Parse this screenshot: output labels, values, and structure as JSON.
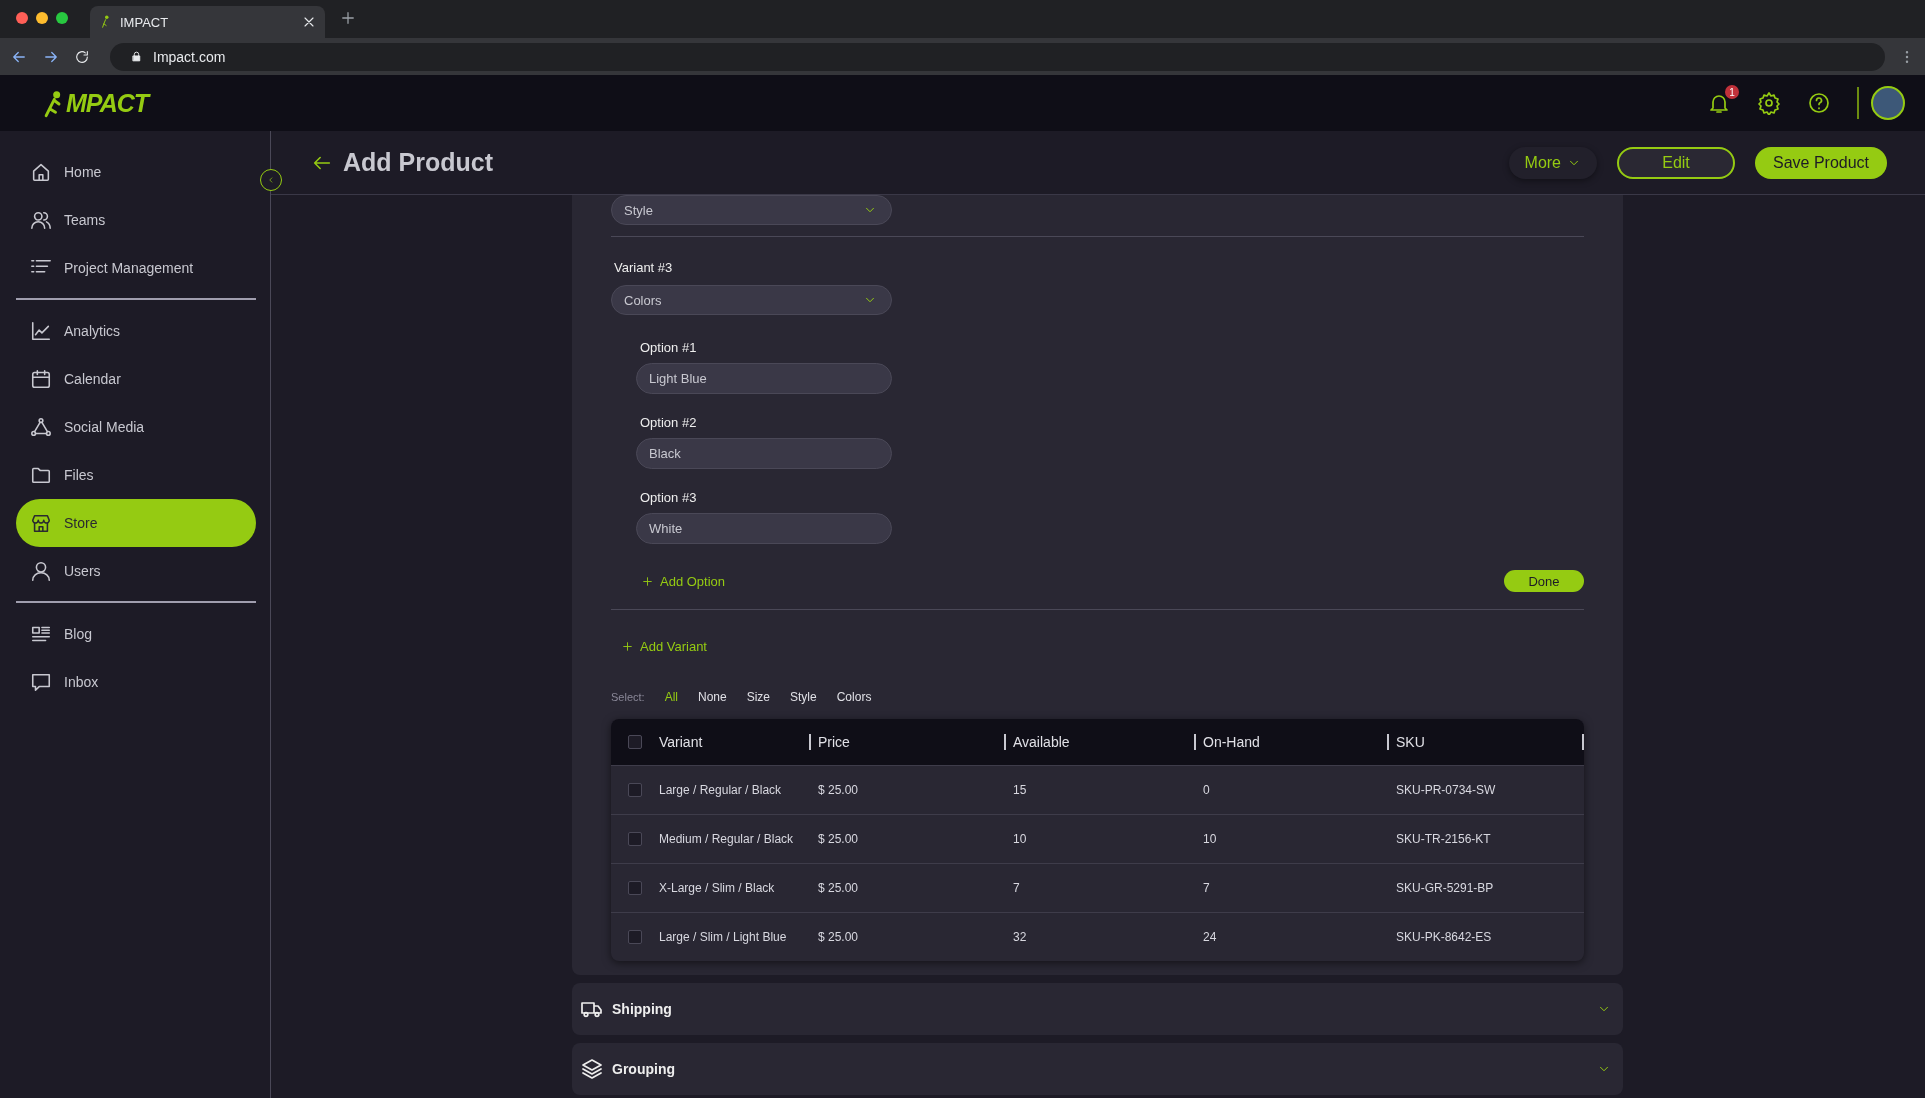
{
  "browser": {
    "tab_title": "IMPACT",
    "url": "Impact.com"
  },
  "app_header": {
    "logo": "MPACT",
    "notification_count": "1"
  },
  "sidebar": {
    "groups": [
      {
        "items": [
          {
            "label": "Home",
            "selected": false
          },
          {
            "label": "Teams",
            "selected": false
          },
          {
            "label": "Project Management",
            "selected": false
          }
        ]
      },
      {
        "items": [
          {
            "label": "Analytics",
            "selected": false
          },
          {
            "label": "Calendar",
            "selected": false
          },
          {
            "label": "Social Media",
            "selected": false
          },
          {
            "label": "Files",
            "selected": false
          },
          {
            "label": "Store",
            "selected": true
          },
          {
            "label": "Users",
            "selected": false
          }
        ]
      },
      {
        "items": [
          {
            "label": "Blog",
            "selected": false
          },
          {
            "label": "Inbox",
            "selected": false
          }
        ]
      }
    ]
  },
  "page_header": {
    "title": "Add Product",
    "buttons": [
      {
        "label": "More",
        "kind": "menu"
      },
      {
        "label": "Edit",
        "kind": "outline"
      },
      {
        "label": "Save Product",
        "kind": "primary"
      }
    ]
  },
  "variants": {
    "previous_select": "Style",
    "current": {
      "label": "Variant #3",
      "value": "Colors",
      "options": [
        {
          "label": "Option #1",
          "value": "Light Blue"
        },
        {
          "label": "Option #2",
          "value": "Black"
        },
        {
          "label": "Option #3",
          "value": "White"
        }
      ],
      "add_option": "Add Option",
      "done": "Done"
    },
    "add_variant": "Add Variant"
  },
  "select_filter": {
    "label": "Select:",
    "items": [
      {
        "label": "All",
        "selected": true
      },
      {
        "label": "None",
        "selected": false
      },
      {
        "label": "Size",
        "selected": false
      },
      {
        "label": "Style",
        "selected": false
      },
      {
        "label": "Colors",
        "selected": false
      }
    ]
  },
  "table": {
    "all_checked": false,
    "columns": [
      "Variant",
      "Price",
      "Available",
      "On-Hand",
      "SKU"
    ],
    "rows": [
      {
        "checked": false,
        "cells": [
          "Large / Regular / Black",
          "$ 25.00",
          "15",
          "0",
          "SKU-PR-0734-SW"
        ]
      },
      {
        "checked": false,
        "cells": [
          "Medium / Regular / Black",
          "$ 25.00",
          "10",
          "10",
          "SKU-TR-2156-KT"
        ]
      },
      {
        "checked": false,
        "cells": [
          "X-Large / Slim / Black",
          "$ 25.00",
          "7",
          "7",
          "SKU-GR-5291-BP"
        ]
      },
      {
        "checked": false,
        "cells": [
          "Large / Slim / Light Blue",
          "$ 25.00",
          "32",
          "24",
          "SKU-PK-8642-ES"
        ]
      }
    ]
  },
  "panels": [
    {
      "title": "Shipping",
      "kind": "truck",
      "expanded": false
    },
    {
      "title": "Grouping",
      "kind": "layers",
      "expanded": false
    }
  ]
}
